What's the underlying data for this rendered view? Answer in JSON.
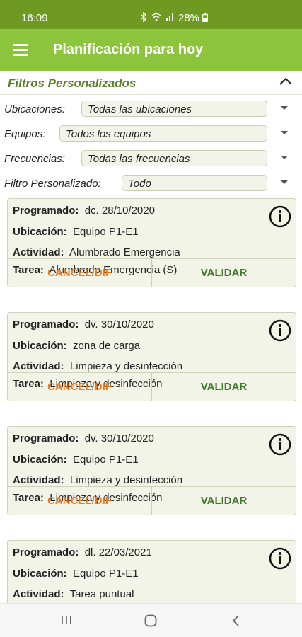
{
  "status_bar": {
    "time": "16:09",
    "battery": "28%",
    "icons": [
      "bluetooth-icon",
      "wifi-icon",
      "signal-icon",
      "battery-icon"
    ]
  },
  "app_bar": {
    "title": "Planificación para hoy"
  },
  "filters": {
    "title": "Filtros Personalizados",
    "rows": [
      {
        "label": "Ubicaciones:",
        "value": "Todas las ubicaciones"
      },
      {
        "label": "Equipos:",
        "value": "Todos los equipos"
      },
      {
        "label": "Frecuencias:",
        "value": "Todas las frecuencias"
      },
      {
        "label": "Filtro Personalizado:",
        "value": "Todo"
      }
    ]
  },
  "cards": [
    {
      "programado_label": "Programado:",
      "programado": "dc. 28/10/2020",
      "ubicacion_label": "Ubicación:",
      "ubicacion": "Equipo P1-E1",
      "actividad_label": "Actividad:",
      "actividad": "Alumbrado Emergencia",
      "tarea_label": "Tarea:",
      "tarea": "Alumbrado Emergencia (S)",
      "cancel": "CANCEL/DIF",
      "validar": "VALIDAR"
    },
    {
      "programado_label": "Programado:",
      "programado": "dv. 30/10/2020",
      "ubicacion_label": "Ubicación:",
      "ubicacion": "zona de carga",
      "actividad_label": "Actividad:",
      "actividad": "Limpieza y desinfección",
      "tarea_label": "Tarea:",
      "tarea": "Limpieza y desinfección",
      "cancel": "CANCEL/DIF",
      "validar": "VALIDAR"
    },
    {
      "programado_label": "Programado:",
      "programado": "dv. 30/10/2020",
      "ubicacion_label": "Ubicación:",
      "ubicacion": "Equipo P1-E1",
      "actividad_label": "Actividad:",
      "actividad": "Limpieza y desinfección",
      "tarea_label": "Tarea:",
      "tarea": "Limpieza y desinfección",
      "cancel": "CANCEL/DIF",
      "validar": "VALIDAR"
    },
    {
      "programado_label": "Programado:",
      "programado": "dl. 22/03/2021",
      "ubicacion_label": "Ubicación:",
      "ubicacion": "Equipo P1-E1",
      "actividad_label": "Actividad:",
      "actividad": "Tarea puntual"
    }
  ],
  "colors": {
    "status_bar": "#6e9a22",
    "app_bar": "#8cc43c",
    "card_bg": "#f3f4e8",
    "cancel": "#ef7a1a",
    "validar": "#3e7a2a",
    "filters_title": "#5a7f2a"
  },
  "nav_bar": {
    "icons": [
      "recent-apps-icon",
      "home-icon",
      "back-icon"
    ]
  }
}
